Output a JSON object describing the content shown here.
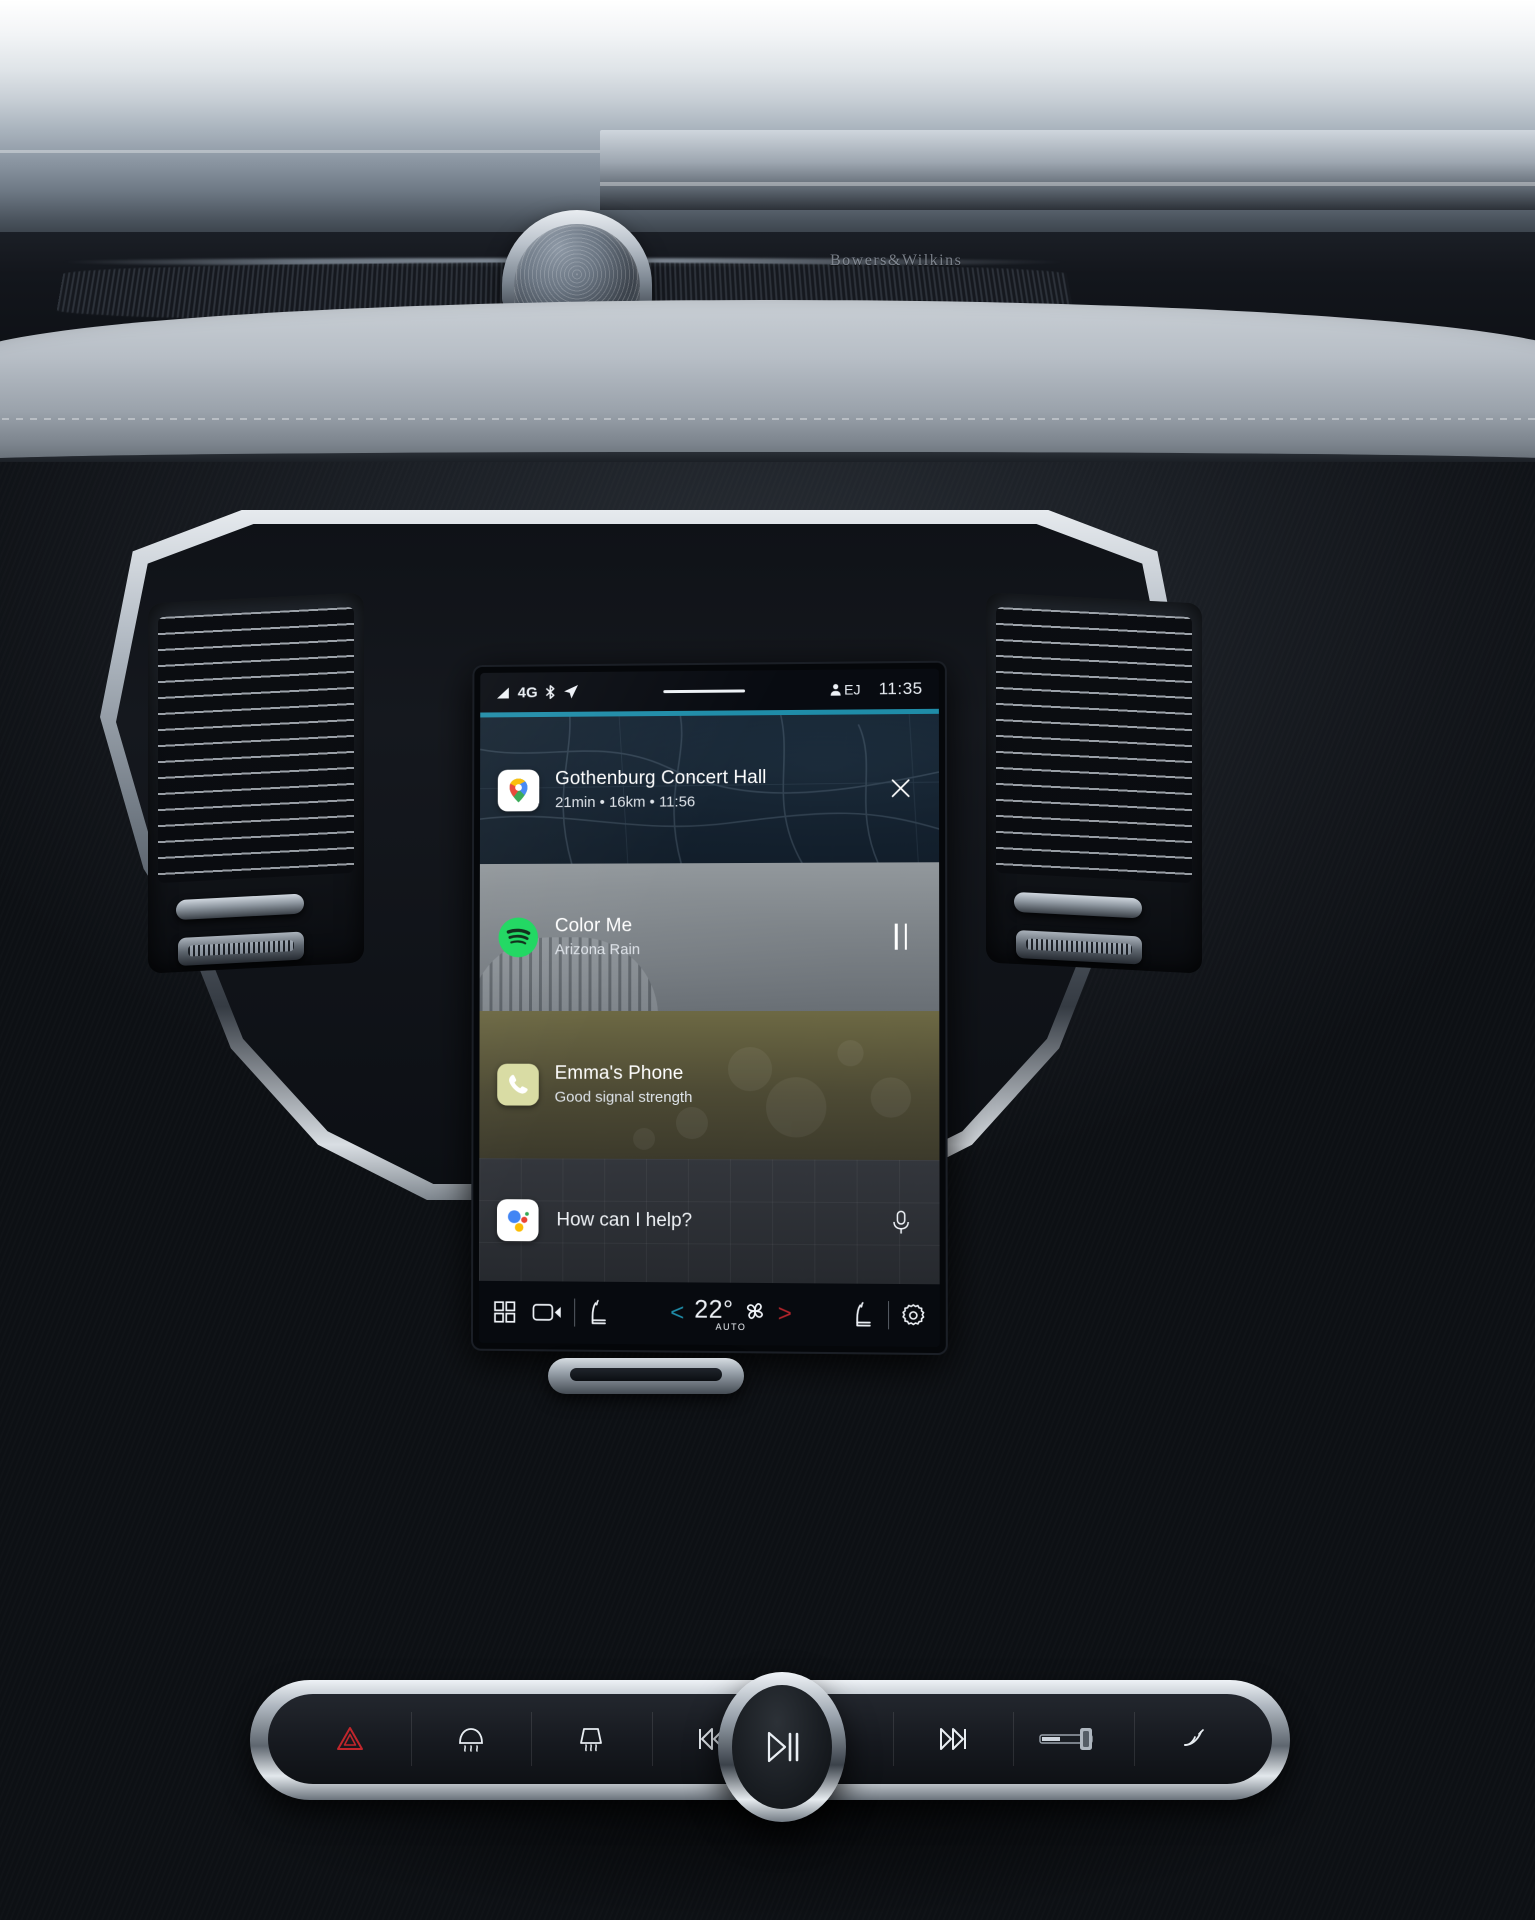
{
  "scene": {
    "brand_plate": "Bowers&Wilkins"
  },
  "screen": {
    "statusbar": {
      "network": "4G",
      "signal_icon": "signal-bars-icon",
      "bluetooth_icon": "bluetooth-icon",
      "navigation_icon": "navigation-arrow-icon",
      "handle_icon": "drag-handle-icon",
      "profile_icon": "user-profile-icon",
      "profile_initials": "EJ",
      "clock": "11:35"
    },
    "accent_color": "#1f8ca8",
    "cards": [
      {
        "id": "navigation",
        "app_icon": "google-maps-icon",
        "title": "Gothenburg Concert Hall",
        "subtitle": "21min • 16km • 11:56",
        "action_icon": "close-icon",
        "action_label": "×"
      },
      {
        "id": "media",
        "app_icon": "spotify-icon",
        "title": "Color Me",
        "subtitle": "Arizona Rain",
        "action_icon": "pause-icon",
        "action_label": ""
      },
      {
        "id": "phone",
        "app_icon": "phone-icon",
        "title": "Emma's Phone",
        "subtitle": "Good signal strength",
        "action_icon": "",
        "action_label": ""
      }
    ],
    "assistant": {
      "app_icon": "google-assistant-icon",
      "prompt": "How can I help?",
      "mic_icon": "microphone-icon"
    },
    "controlbar": {
      "apps_label": "apps-grid-icon",
      "camera_label": "camera-icon",
      "seat_left_label": "seat-heater-left-icon",
      "decrease_label": "<",
      "temperature": "22°",
      "temp_mode": "AUTO",
      "fan_label": "fan-icon",
      "increase_label": ">",
      "seat_right_label": "seat-heater-right-icon",
      "settings_label": "settings-gear-icon"
    }
  },
  "console": {
    "buttons": [
      {
        "id": "hazard",
        "icon": "hazard-triangle-icon"
      },
      {
        "id": "rear-defrost",
        "icon": "rear-window-defrost-icon"
      },
      {
        "id": "front-defrost",
        "icon": "front-windshield-defrost-icon"
      },
      {
        "id": "previous",
        "icon": "previous-track-icon"
      },
      {
        "id": "play-pause",
        "icon": "play-pause-icon"
      },
      {
        "id": "next",
        "icon": "next-track-icon"
      },
      {
        "id": "volume",
        "icon": "volume-slider-icon"
      },
      {
        "id": "mute",
        "icon": "mute-icon"
      }
    ]
  }
}
